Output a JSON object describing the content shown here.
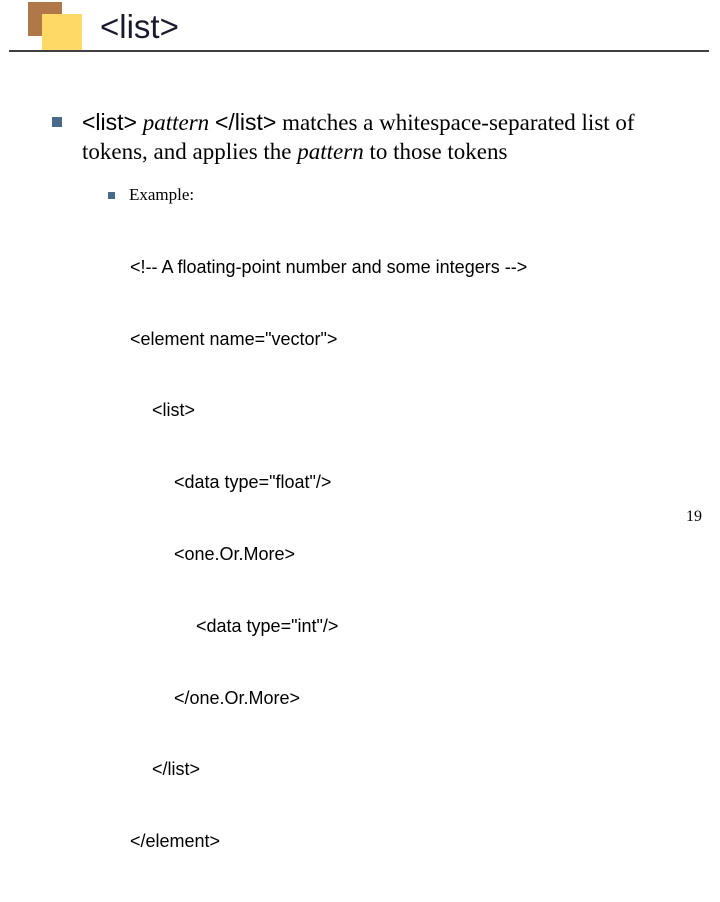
{
  "slide": {
    "title": "<list>",
    "pageNumber": "19"
  },
  "main": {
    "tag_open": "<list>",
    "pattern_word": "pattern ",
    "tag_close": "</list>",
    "after_close": " matches a whitespace-separated list of tokens, and applies the ",
    "pattern_word2": "pattern ",
    "tail": " to those tokens"
  },
  "example": {
    "label": "Example:",
    "lines": [
      {
        "indent": 0,
        "text": "<!-- A floating-point number and some integers -->"
      },
      {
        "indent": 0,
        "text": "<element name=\"vector\">"
      },
      {
        "indent": 1,
        "text": "<list>"
      },
      {
        "indent": 2,
        "text": "<data type=\"float\"/>"
      },
      {
        "indent": 2,
        "text": "<one.Or.More>"
      },
      {
        "indent": 3,
        "text": "<data type=\"int\"/>"
      },
      {
        "indent": 2,
        "text": "</one.Or.More>"
      },
      {
        "indent": 1,
        "text": "</list>"
      },
      {
        "indent": 0,
        "text": "</element>"
      }
    ]
  }
}
